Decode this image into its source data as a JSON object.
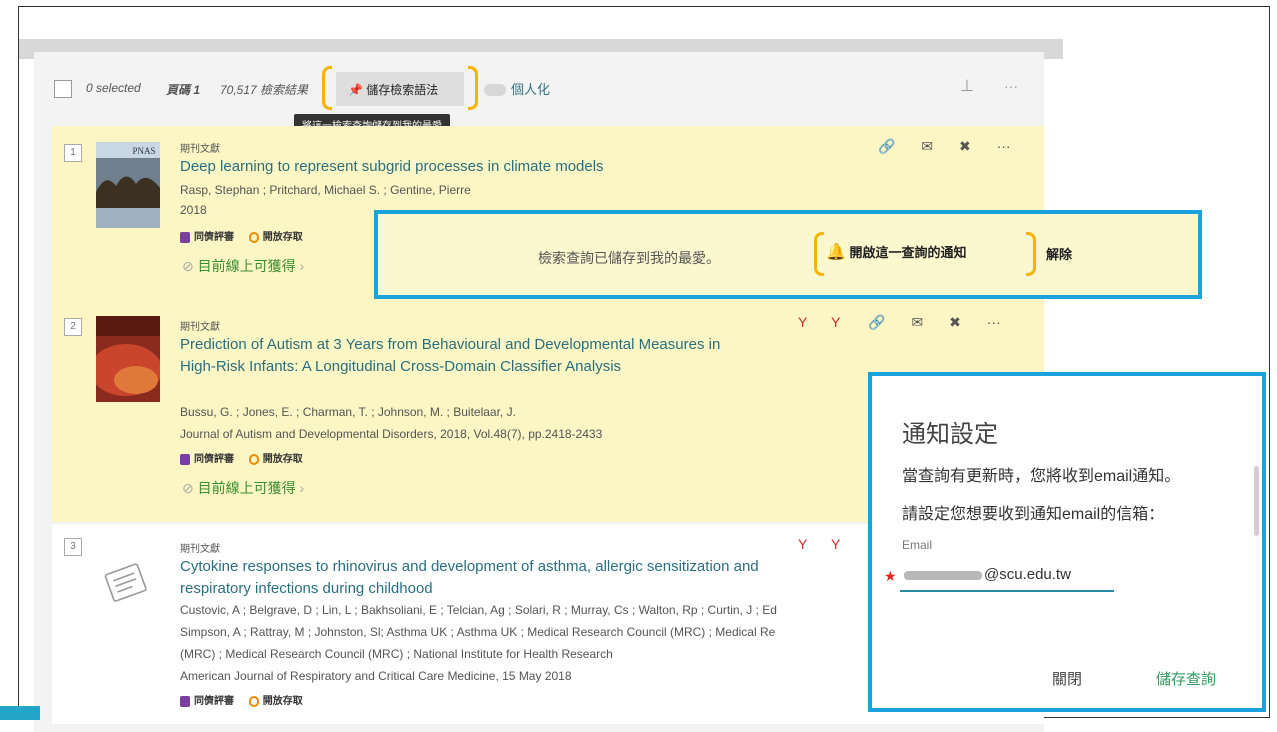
{
  "toolbar": {
    "selected": "0 selected",
    "page_label": "頁碼 1",
    "count": "70,517 檢索結果",
    "save_query": "儲存檢索語法",
    "personalize": "個人化",
    "tooltip": "將這一檢索查詢儲存到我的最愛"
  },
  "results": [
    {
      "num": "1",
      "type": "期刊文獻",
      "title": "Deep learning to represent subgrid processes in climate models",
      "authors": "Rasp, Stephan ; Pritchard, Michael S. ; Gentine, Pierre",
      "year": "2018",
      "peer": "同儕評審",
      "oa": "開放存取",
      "avail": "目前線上可獲得",
      "cover_text": "PNAS"
    },
    {
      "num": "2",
      "type": "期刊文獻",
      "title": "Prediction of Autism at 3 Years from Behavioural and Developmental Measures in High-Risk Infants: A Longitudinal Cross-Domain Classifier Analysis",
      "authors": "Bussu, G. ; Jones, E. ; Charman, T. ; Johnson, M. ; Buitelaar, J.",
      "source": "Journal of Autism and Developmental Disorders, 2018, Vol.48(7), pp.2418-2433",
      "peer": "同儕評審",
      "oa": "開放存取",
      "avail": "目前線上可獲得"
    },
    {
      "num": "3",
      "type": "期刊文獻",
      "title": "Cytokine responses to rhinovirus and development of asthma, allergic sensitization and respiratory infections during childhood",
      "authors1": "Custovic, A ; Belgrave, D ; Lin, L ; Bakhsoliani, E ; Telcian, Ag ; Solari, R ; Murray, Cs ; Walton, Rp ; Curtin, J ; Ed",
      "authors2": "Simpson, A ; Rattray, M ; Johnston, Sl; Asthma UK ; Asthma UK ; Medical Research Council (MRC) ; Medical Re",
      "authors3": "(MRC) ; Medical Research Council (MRC) ; National Institute for Health Research",
      "source": "American Journal of Respiratory and Critical Care Medicine, 15 May 2018",
      "peer": "同儕評審",
      "oa": "開放存取"
    }
  ],
  "saved_banner": {
    "message": "檢索查詢已儲存到我的最愛。",
    "notify": "開啟這一查詢的通知",
    "dismiss": "解除"
  },
  "dialog": {
    "title": "通知設定",
    "line1": "當查詢有更新時，您將收到email通知。",
    "line2": "請設定您想要收到通知email的信箱：",
    "email_label": "Email",
    "email_value": "@scu.edu.tw",
    "close": "關閉",
    "save": "儲存查詢"
  },
  "colors": {
    "highlight": "#fbf6c4",
    "link_teal": "#2a6f7f",
    "callout_blue": "#1aa2dc",
    "bracket_orange": "#f6b400",
    "green": "#3b8e2f"
  }
}
